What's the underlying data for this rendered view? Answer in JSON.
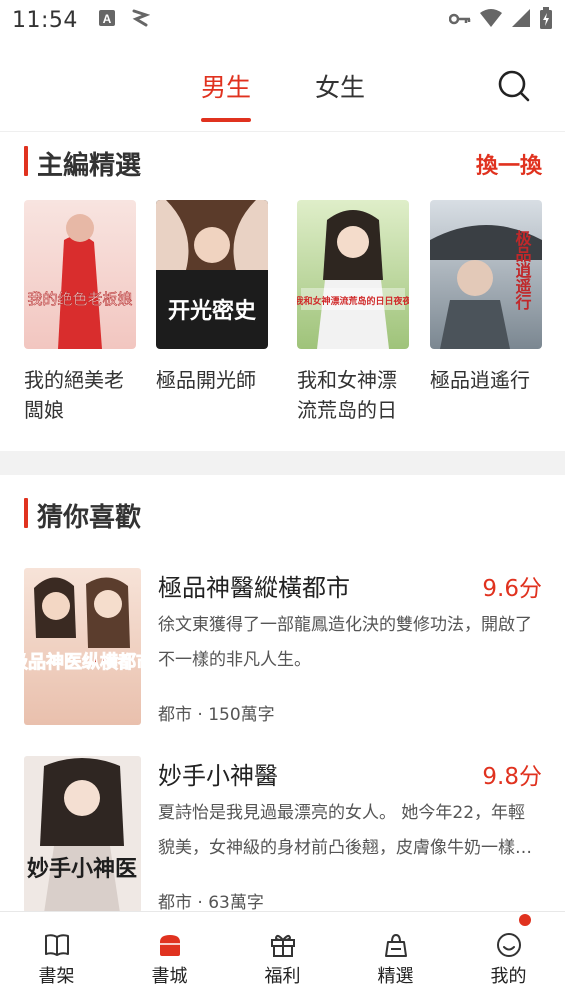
{
  "status_bar": {
    "time": "11:54",
    "left_icons": [
      "font-a-icon",
      "signal-spark-icon"
    ],
    "right_icons": [
      "key-icon",
      "wifi-icon",
      "cell-signal-icon",
      "battery-charging-icon"
    ]
  },
  "top_tabs": {
    "tabs": [
      {
        "label": "男生",
        "active": true
      },
      {
        "label": "女生",
        "active": false
      }
    ],
    "search_icon": "search-icon"
  },
  "editor_picks": {
    "title": "主編精選",
    "refresh_label": "換一換",
    "books": [
      {
        "title": "我的絕美老闆娘",
        "cover_text": "我的绝色老板娘",
        "cover_colors": [
          "#f6dad6",
          "#d92d2d"
        ]
      },
      {
        "title": "極品開光師",
        "cover_text": "开光密史",
        "cover_colors": [
          "#e8c9b8",
          "#1a1a1a"
        ]
      },
      {
        "title": "我和女神漂流荒岛的日",
        "cover_text": "我和女神漂流荒岛的日日夜夜",
        "cover_colors": [
          "#c8dfa9",
          "#5c7c3a"
        ]
      },
      {
        "title": "極品逍遙行",
        "cover_text": "极品逍遥行",
        "cover_colors": [
          "#c2cdd6",
          "#52606c"
        ]
      }
    ]
  },
  "recommend": {
    "title": "猜你喜歡",
    "books": [
      {
        "title": "極品神醫縱橫都市",
        "score": "9.6分",
        "desc": "徐文東獲得了一部龍鳳造化決的雙修功法，開啟了不一樣的非凡人生。",
        "meta": "都市 · 150萬字",
        "cover_text": "极品神医纵横都市",
        "cover_colors": [
          "#f3d9cd",
          "#c2392b"
        ]
      },
      {
        "title": "妙手小神醫",
        "score": "9.8分",
        "desc": "夏詩怡是我見過最漂亮的女人。 她今年22，年輕貌美，女神級的身材前凸後翹，皮膚像牛奶一樣白嫩。",
        "meta": "都市 · 63萬字",
        "cover_text": "妙手小神医",
        "cover_colors": [
          "#efe7e3",
          "#2a2a2a"
        ]
      }
    ]
  },
  "bottom_nav": {
    "items": [
      {
        "label": "書架",
        "icon": "book-icon",
        "active": false
      },
      {
        "label": "書城",
        "icon": "store-icon",
        "active": true
      },
      {
        "label": "福利",
        "icon": "gift-icon",
        "active": false
      },
      {
        "label": "精選",
        "icon": "bag-icon",
        "active": false
      },
      {
        "label": "我的",
        "icon": "smile-icon",
        "active": false,
        "badge": true
      }
    ]
  },
  "colors": {
    "accent": "#e0321f",
    "divider": "#f2f2f2"
  }
}
